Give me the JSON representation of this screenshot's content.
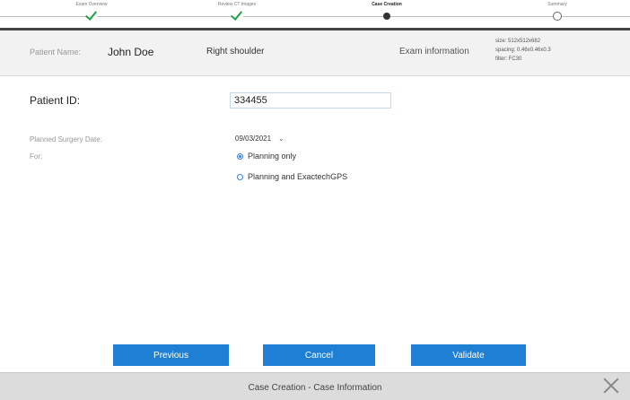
{
  "stepper": {
    "steps": [
      {
        "label": "Exam Overview",
        "state": "completed",
        "icon": "check-icon"
      },
      {
        "label": "Review CT Images",
        "state": "completed",
        "icon": "check-icon"
      },
      {
        "label": "Case Creation",
        "state": "current",
        "icon": "dot-icon"
      },
      {
        "label": "Summary",
        "state": "upcoming",
        "icon": "circle-icon"
      }
    ]
  },
  "patient_header": {
    "name_label": "Patient Name:",
    "name": "John Doe",
    "site": "Right shoulder",
    "exam_label": "Exam information",
    "exam_details": [
      "size: 512x512x682",
      "spacing: 0.46x0.46x0.3",
      "filter: FC30"
    ]
  },
  "form": {
    "patient_id_label": "Patient ID:",
    "patient_id_value": "334455",
    "date_label": "Planned Surgery Date:",
    "date_value": "09/03/2021",
    "for_label": "For:",
    "options": [
      {
        "label": "Planning only",
        "checked": true
      },
      {
        "label": "Planning and ExactechGPS",
        "checked": false
      }
    ]
  },
  "buttons": {
    "previous": "Previous",
    "cancel": "Cancel",
    "validate": "Validate"
  },
  "footer": {
    "title": "Case Creation - Case Information"
  },
  "colors": {
    "accent": "#1e7fd3",
    "check": "#1f9e4a",
    "header_bg": "#f2f2f2",
    "footer_bg": "#dcdcdc"
  }
}
